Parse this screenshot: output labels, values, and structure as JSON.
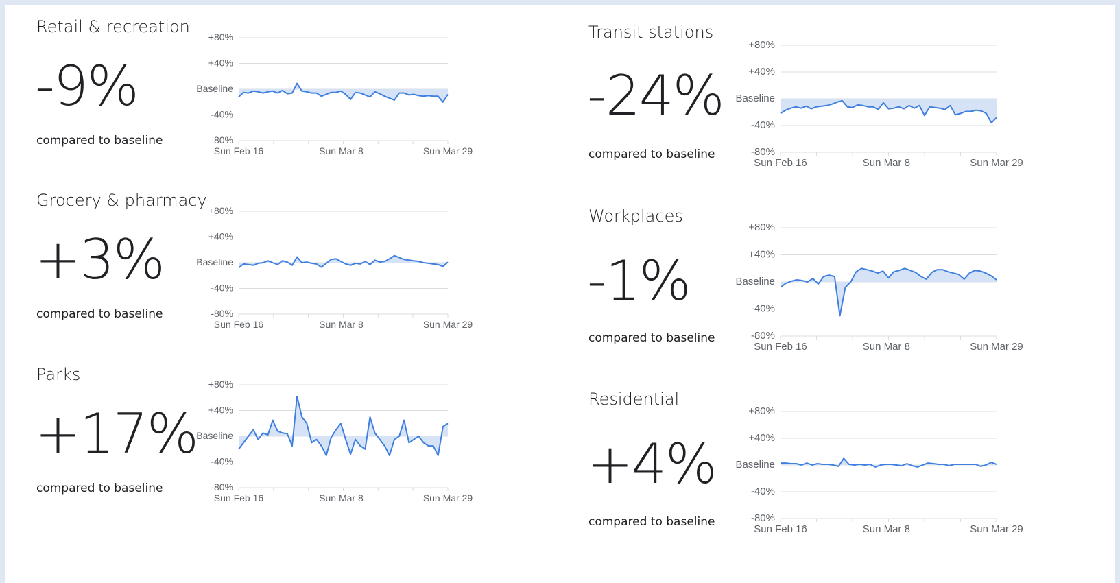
{
  "compared_label": "compared to baseline",
  "colors": {
    "line": "#3f7fe0",
    "fill": "#d6e3f7",
    "grid": "#dadce0",
    "axis": "#5f6368",
    "text": "#202124"
  },
  "y_ticks": [
    "+80%",
    "+40%",
    "Baseline",
    "-40%",
    "-80%"
  ],
  "x_ticks": [
    "Sun Feb 16",
    "Sun Mar 8",
    "Sun Mar 29"
  ],
  "chart_data": [
    {
      "type": "area",
      "title": "Retail & recreation",
      "headline": "-9%",
      "x_range": [
        "Sun Feb 16",
        "Sun Mar 29"
      ],
      "ylim": [
        -80,
        80
      ],
      "grid": true,
      "values": [
        -12,
        -5,
        -6,
        -3,
        -4,
        -6,
        -4,
        -3,
        -6,
        -2,
        -7,
        -6,
        9,
        -3,
        -4,
        -6,
        -6,
        -11,
        -8,
        -5,
        -5,
        -3,
        -8,
        -16,
        -5,
        -6,
        -9,
        -12,
        -4,
        -7,
        -11,
        -14,
        -17,
        -6,
        -6,
        -9,
        -8,
        -10,
        -11,
        -10,
        -11,
        -11,
        -20,
        -8
      ]
    },
    {
      "type": "area",
      "title": "Grocery & pharmacy",
      "headline": "+3%",
      "x_range": [
        "Sun Feb 16",
        "Sun Mar 29"
      ],
      "ylim": [
        -80,
        80
      ],
      "grid": true,
      "values": [
        -8,
        -2,
        -3,
        -4,
        -1,
        0,
        3,
        0,
        -3,
        3,
        1,
        -4,
        9,
        0,
        1,
        -1,
        -2,
        -7,
        -1,
        5,
        6,
        2,
        -2,
        -4,
        -1,
        -2,
        2,
        -3,
        4,
        1,
        2,
        6,
        11,
        8,
        5,
        4,
        3,
        2,
        0,
        -1,
        -2,
        -3,
        -6,
        1
      ]
    },
    {
      "type": "area",
      "title": "Parks",
      "headline": "+17%",
      "x_range": [
        "Sun Feb 16",
        "Sun Mar 29"
      ],
      "ylim": [
        -80,
        80
      ],
      "grid": true,
      "values": [
        -20,
        -10,
        0,
        10,
        -5,
        5,
        2,
        25,
        8,
        5,
        4,
        -15,
        62,
        30,
        20,
        -10,
        -5,
        -15,
        -30,
        -2,
        10,
        20,
        -5,
        -28,
        -5,
        -15,
        -20,
        30,
        5,
        -5,
        -15,
        -30,
        -5,
        0,
        25,
        -10,
        -5,
        0,
        -10,
        -15,
        -15,
        -30,
        15,
        20
      ]
    },
    {
      "type": "area",
      "title": "Transit stations",
      "headline": "-24%",
      "x_range": [
        "Sun Feb 16",
        "Sun Mar 29"
      ],
      "ylim": [
        -80,
        80
      ],
      "grid": true,
      "values": [
        -22,
        -17,
        -14,
        -12,
        -14,
        -11,
        -15,
        -12,
        -11,
        -10,
        -8,
        -5,
        -3,
        -12,
        -13,
        -9,
        -10,
        -12,
        -12,
        -16,
        -6,
        -15,
        -14,
        -12,
        -15,
        -10,
        -14,
        -10,
        -25,
        -12,
        -13,
        -14,
        -16,
        -10,
        -24,
        -22,
        -19,
        -19,
        -17,
        -18,
        -22,
        -36,
        -28
      ]
    },
    {
      "type": "area",
      "title": "Workplaces",
      "headline": "-1%",
      "x_range": [
        "Sun Feb 16",
        "Sun Mar 29"
      ],
      "ylim": [
        -80,
        80
      ],
      "grid": true,
      "values": [
        -8,
        -2,
        1,
        3,
        2,
        0,
        5,
        -3,
        8,
        10,
        8,
        -50,
        -8,
        0,
        15,
        20,
        18,
        16,
        13,
        16,
        6,
        15,
        17,
        20,
        17,
        14,
        8,
        4,
        14,
        18,
        18,
        15,
        13,
        11,
        4,
        13,
        17,
        16,
        13,
        9,
        3
      ]
    },
    {
      "type": "area",
      "title": "Residential",
      "headline": "+4%",
      "x_range": [
        "Sun Feb 16",
        "Sun Mar 29"
      ],
      "ylim": [
        -80,
        80
      ],
      "grid": true,
      "values": [
        3,
        3,
        2,
        2,
        0,
        3,
        0,
        2,
        1,
        1,
        0,
        -2,
        10,
        1,
        0,
        1,
        0,
        1,
        -3,
        0,
        1,
        1,
        0,
        -1,
        2,
        -1,
        -3,
        0,
        3,
        2,
        1,
        1,
        -1,
        1,
        1,
        1,
        1,
        1,
        -2,
        0,
        4,
        1
      ]
    }
  ]
}
